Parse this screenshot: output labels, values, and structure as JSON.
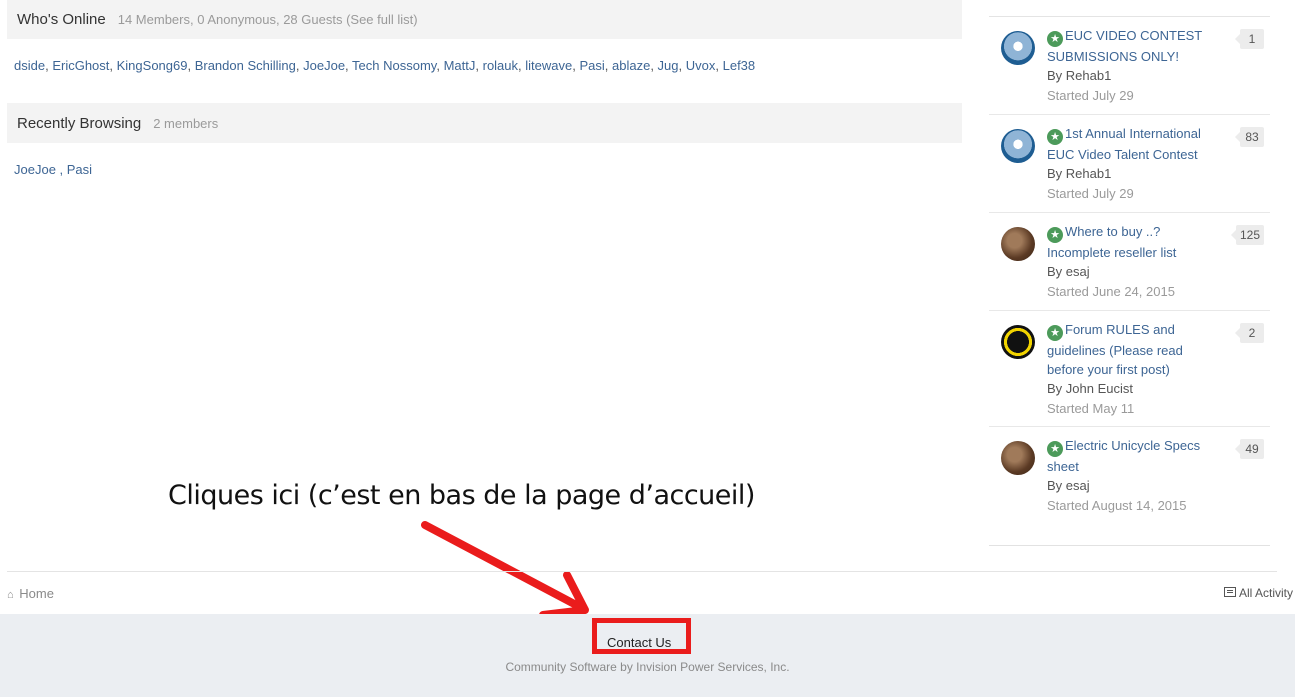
{
  "whos_online": {
    "title": "Who's Online",
    "meta": "14 Members, 0 Anonymous, 28 Guests (See full list)",
    "members": [
      "dside",
      "EricGhost",
      "KingSong69",
      "Brandon Schilling",
      "JoeJoe",
      "Tech Nossomy",
      "MattJ",
      "rolauk",
      "litewave",
      "Pasi",
      "ablaze",
      "Jug",
      "Uvox",
      "Lef38"
    ]
  },
  "recently_browsing": {
    "title": "Recently Browsing",
    "meta": "2 members",
    "members": [
      "JoeJoe",
      "Pasi"
    ]
  },
  "topics": [
    {
      "title": "EUC VIDEO CONTEST SUBMISSIONS ONLY!",
      "by_prefix": "By",
      "author": "Rehab1",
      "started": "Started July 29",
      "count": "1",
      "avatar": "euc-logo",
      "pinned_icon": "star-icon"
    },
    {
      "title": "1st Annual International EUC Video Talent Contest",
      "by_prefix": "By",
      "author": "Rehab1",
      "started": "Started July 29",
      "count": "83",
      "avatar": "euc-logo",
      "pinned_icon": "star-icon"
    },
    {
      "title": "Where to buy ..? Incomplete reseller list",
      "by_prefix": "By",
      "author": "esaj",
      "started": "Started June 24, 2015",
      "count": "125",
      "avatar": "esaj-photo",
      "pinned_icon": "star-icon"
    },
    {
      "title": "Forum RULES and guidelines (Please read before your first post)",
      "by_prefix": "By",
      "author": "John Eucist",
      "started": "Started May 11",
      "count": "2",
      "avatar": "eucist-ring",
      "pinned_icon": "star-icon"
    },
    {
      "title": "Electric Unicycle Specs sheet",
      "by_prefix": "By",
      "author": "esaj",
      "started": "Started August 14, 2015",
      "count": "49",
      "avatar": "esaj-photo",
      "pinned_icon": "star-icon"
    }
  ],
  "annotation": {
    "text": "Cliques ici (c’est en bas de la page d’accueil)",
    "arrow_color": "#ea1c1c"
  },
  "breadcrumb": {
    "home_label": "Home",
    "home_icon": "home-icon",
    "all_activity_label": "All Activity",
    "all_activity_icon": "activity-icon"
  },
  "footer": {
    "contact_label": "Contact Us",
    "copyright": "Community Software by Invision Power Services, Inc.",
    "highlight_color": "#ea1c1c"
  },
  "colors": {
    "link": "#3d6594",
    "pinned_star": "#4c9a5a",
    "footer_bg": "#ebeef2"
  }
}
